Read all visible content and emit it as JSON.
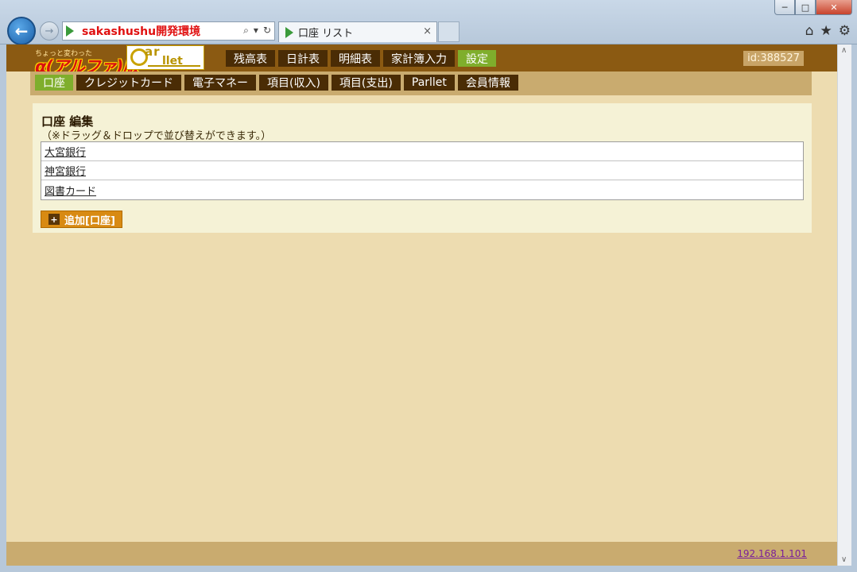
{
  "browser": {
    "address": "sakashushu開発環境",
    "tab_title": "口座 リスト",
    "tab_close": "×",
    "window_buttons": {
      "minimize": "─",
      "maximize": "□",
      "close": "✕"
    },
    "icons": [
      "home-icon",
      "star-icon",
      "gear-icon"
    ]
  },
  "header": {
    "logo_small": "ちょっと変わった",
    "logo_big": "α(アルファ)版",
    "parllet_top": "ar",
    "parllet_bottom": "llet",
    "nav": [
      {
        "label": "残高表",
        "active": false
      },
      {
        "label": "日計表",
        "active": false
      },
      {
        "label": "明細表",
        "active": false
      },
      {
        "label": "家計簿入力",
        "active": false
      },
      {
        "label": "設定",
        "active": true
      }
    ],
    "user_id": "id:388527"
  },
  "subnav": [
    {
      "label": "口座",
      "active": true
    },
    {
      "label": "クレジットカード",
      "active": false
    },
    {
      "label": "電子マネー",
      "active": false
    },
    {
      "label": "項目(収入)",
      "active": false
    },
    {
      "label": "項目(支出)",
      "active": false
    },
    {
      "label": "Parllet",
      "active": false
    },
    {
      "label": "会員情報",
      "active": false
    }
  ],
  "panel": {
    "title": "口座  編集",
    "note": "（※ドラッグ＆ドロップで並び替えができます。）",
    "accounts": [
      "大宮銀行",
      "神宮銀行",
      "図書カード"
    ],
    "add_button": "追加[口座]",
    "add_icon": "+"
  },
  "footer": {
    "link": "192.168.1.101"
  },
  "colors": {
    "topbar": "#8b5a12",
    "nav_button": "#4a2c05",
    "active": "#7fae2c",
    "page_bg": "#eddcb0",
    "panel_bg": "#f5f2d6",
    "add_button": "#d88a12"
  }
}
